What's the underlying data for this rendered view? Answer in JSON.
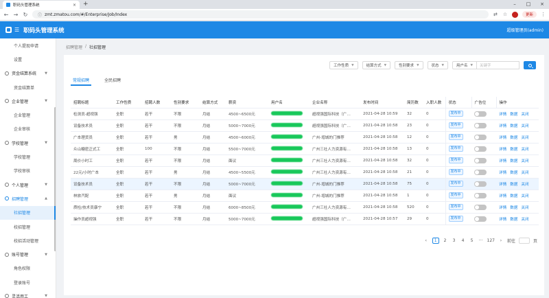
{
  "browser": {
    "tab_title": "职码头管理系统",
    "url": "zmt.zmatou.com/#/Enterprise/Job/Index",
    "update_label": "更新"
  },
  "app": {
    "title": "职码头管理系统",
    "user": "超级管理员(admin)"
  },
  "sidebar": [
    {
      "label": "个人提现申请",
      "type": "item"
    },
    {
      "label": "设置",
      "type": "item"
    },
    {
      "label": "资金结算系统",
      "type": "group"
    },
    {
      "label": "资金结算单",
      "type": "item"
    },
    {
      "label": "企业管理",
      "type": "group"
    },
    {
      "label": "企业管理",
      "type": "item"
    },
    {
      "label": "企业审核",
      "type": "item"
    },
    {
      "label": "学校管理",
      "type": "group"
    },
    {
      "label": "学校管理",
      "type": "item"
    },
    {
      "label": "学校审核",
      "type": "item"
    },
    {
      "label": "个人管理",
      "type": "group"
    },
    {
      "label": "招聘管理",
      "type": "group",
      "active_group": true
    },
    {
      "label": "社招管理",
      "type": "item",
      "active": true
    },
    {
      "label": "校招管理",
      "type": "item"
    },
    {
      "label": "校招活动管理",
      "type": "item"
    },
    {
      "label": "账号管理",
      "type": "group"
    },
    {
      "label": "角色权限",
      "type": "item"
    },
    {
      "label": "登录账号",
      "type": "item"
    },
    {
      "label": "灵活用工",
      "type": "group"
    }
  ],
  "breadcrumb": {
    "parent": "招聘管理",
    "current": "社招管理"
  },
  "filters": {
    "job_nature": "工作性质",
    "settlement": "结算方式",
    "gender": "性别要求",
    "status": "状态",
    "user_field": "用户名",
    "keyword_placeholder": "关键字"
  },
  "tabs": [
    "常规招聘",
    "全民招聘"
  ],
  "table": {
    "headers": [
      "招聘标题",
      "工作性质",
      "招聘人数",
      "性别要求",
      "结算方式",
      "薪资",
      "用户名",
      "企业名称",
      "发布时间",
      "简历数",
      "入职人数",
      "状态",
      "广告位",
      "操作"
    ],
    "rows": [
      {
        "title": "检测员-超视强",
        "nature": "全职",
        "count": "若干",
        "gender": "不限",
        "settle": "月结",
        "salary": "4500~6500元",
        "company": "超视强国际科技（广…",
        "time": "2021-04-28 10:59",
        "resumes": "32",
        "hired": "0",
        "status": "发布中"
      },
      {
        "title": "设备技术员",
        "nature": "全职",
        "count": "若干",
        "gender": "不限",
        "settle": "月结",
        "salary": "5000~7000元",
        "company": "超视强国际科技（广…",
        "time": "2021-04-28 10:58",
        "resumes": "23",
        "hired": "0",
        "status": "发布中"
      },
      {
        "title": "广本理货员",
        "nature": "全职",
        "count": "若干",
        "gender": "男",
        "settle": "月结",
        "salary": "4500~6000元",
        "company": "广州-增城的门推荐",
        "time": "2021-04-28 10:58",
        "resumes": "12",
        "hired": "0",
        "status": "发布中"
      },
      {
        "title": "众山糖密正式工",
        "nature": "全职",
        "count": "100",
        "gender": "不限",
        "settle": "月结",
        "salary": "5500~7000元",
        "company": "广州三社人力资源有…",
        "time": "2021-04-28 10:58",
        "resumes": "13",
        "hired": "0",
        "status": "发布中"
      },
      {
        "title": "周价小时工",
        "nature": "全职",
        "count": "若干",
        "gender": "不限",
        "settle": "月结",
        "salary": "面议",
        "company": "广州三社人力资源有…",
        "time": "2021-04-28 10:58",
        "resumes": "32",
        "hired": "0",
        "status": "发布中"
      },
      {
        "title": "22元/小时广本",
        "nature": "全职",
        "count": "若干",
        "gender": "男",
        "settle": "月结",
        "salary": "4500~5500元",
        "company": "广州三社人力资源有…",
        "time": "2021-04-28 10:58",
        "resumes": "21",
        "hired": "0",
        "status": "发布中"
      },
      {
        "title": "设备技术员",
        "nature": "全职",
        "count": "若干",
        "gender": "不限",
        "settle": "月结",
        "salary": "5000~7000元",
        "company": "广州-增城的门推荐",
        "time": "2021-04-28 10:58",
        "resumes": "75",
        "hired": "0",
        "status": "发布中"
      },
      {
        "title": "林旅汽配",
        "nature": "全职",
        "count": "若干",
        "gender": "男",
        "settle": "月结",
        "salary": "面议",
        "company": "广州-增城的门推荐",
        "time": "2021-04-28 10:58",
        "resumes": "1",
        "hired": "0",
        "status": "发布中"
      },
      {
        "title": "质检/技术员康宁",
        "nature": "全职",
        "count": "若干",
        "gender": "不限",
        "settle": "月结",
        "salary": "6000~8500元",
        "company": "广州三社人力资源有…",
        "time": "2021-04-28 10:58",
        "resumes": "520",
        "hired": "0",
        "status": "发布中"
      },
      {
        "title": "操作员超视强",
        "nature": "全职",
        "count": "若干",
        "gender": "不限",
        "settle": "月结",
        "salary": "5000~7000元",
        "company": "超视强国际科技（广…",
        "time": "2021-04-28 10:57",
        "resumes": "29",
        "hired": "0",
        "status": "发布中"
      }
    ],
    "actions": [
      "详情",
      "数据",
      "关闭"
    ]
  },
  "pagination": {
    "pages": [
      "1",
      "2",
      "3",
      "4",
      "5",
      "···",
      "127"
    ],
    "goto_label": "前往",
    "page_suffix": "页"
  }
}
